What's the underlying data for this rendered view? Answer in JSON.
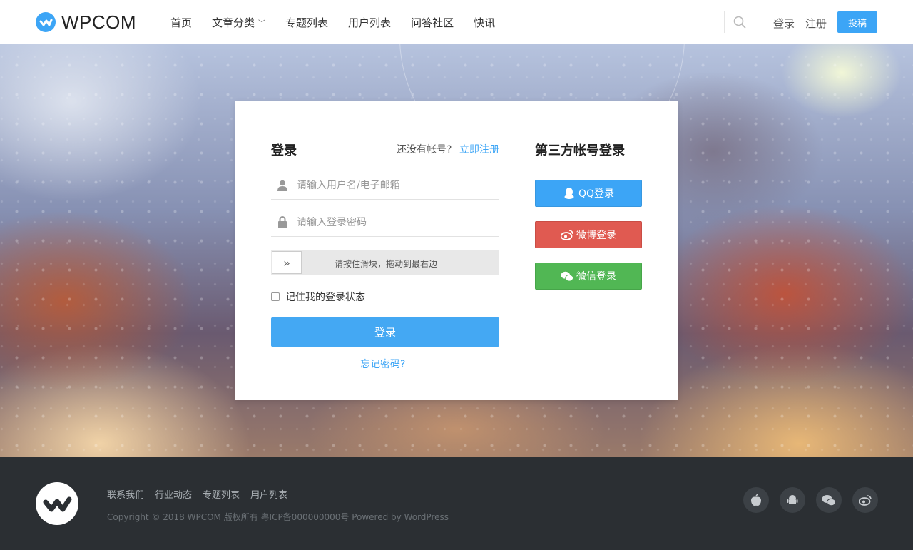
{
  "header": {
    "logo_text": "WPCOM",
    "nav": [
      {
        "label": "首页"
      },
      {
        "label": "文章分类",
        "dropdown": true
      },
      {
        "label": "专题列表"
      },
      {
        "label": "用户列表"
      },
      {
        "label": "问答社区"
      },
      {
        "label": "快讯"
      }
    ],
    "login_label": "登录",
    "register_label": "注册",
    "submit_label": "投稿"
  },
  "login": {
    "title": "登录",
    "no_account": "还没有帐号?",
    "register_link": "立即注册",
    "username_placeholder": "请输入用户名/电子邮箱",
    "password_placeholder": "请输入登录密码",
    "slider_handle": "»",
    "slider_text": "请按住滑块，拖动到最右边",
    "remember_label": "记住我的登录状态",
    "submit_label": "登录",
    "forgot_label": "忘记密码?"
  },
  "social": {
    "title": "第三方帐号登录",
    "qq_label": "QQ登录",
    "weibo_label": "微博登录",
    "wechat_label": "微信登录"
  },
  "footer": {
    "links": [
      "联系我们",
      "行业动态",
      "专题列表",
      "用户列表"
    ],
    "copyright": "Copyright © 2018 WPCOM 版权所有 粤ICP备000000000号 Powered by WordPress",
    "icons": [
      "apple-icon",
      "android-icon",
      "wechat-icon",
      "weibo-icon"
    ]
  },
  "colors": {
    "accent": "#3ca5f6",
    "qq": "#3ca5f6",
    "weibo": "#e05a51",
    "wechat": "#51b754",
    "footer_bg": "#2b2f33"
  }
}
